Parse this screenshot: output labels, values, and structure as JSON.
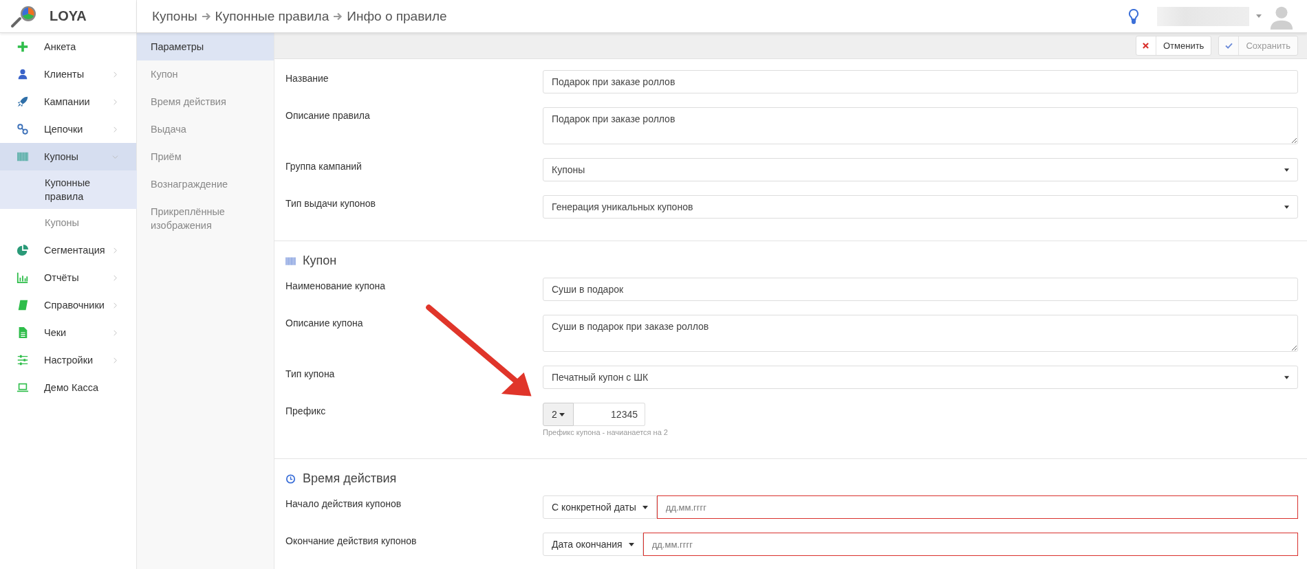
{
  "logo": {
    "name": "LOYA"
  },
  "breadcrumb": [
    "Купоны",
    "Купонные правила",
    "Инфо о правиле"
  ],
  "sidebar": {
    "items": [
      {
        "label": "Анкета",
        "kind": "link",
        "selected": false
      },
      {
        "label": "Клиенты",
        "kind": "group",
        "expanded": false,
        "selected": false
      },
      {
        "label": "Кампании",
        "kind": "group",
        "expanded": false,
        "selected": false
      },
      {
        "label": "Цепочки",
        "kind": "group",
        "expanded": false,
        "selected": false
      },
      {
        "label": "Купоны",
        "kind": "group",
        "expanded": true,
        "selected": true,
        "children": [
          {
            "label": "Купонные правила",
            "selected": true
          },
          {
            "label": "Купоны",
            "selected": false
          }
        ]
      },
      {
        "label": "Сегментация",
        "kind": "group",
        "expanded": false,
        "selected": false
      },
      {
        "label": "Отчёты",
        "kind": "group",
        "expanded": false,
        "selected": false
      },
      {
        "label": "Справочники",
        "kind": "group",
        "expanded": false,
        "selected": false
      },
      {
        "label": "Чеки",
        "kind": "group",
        "expanded": false,
        "selected": false
      },
      {
        "label": "Настройки",
        "kind": "group",
        "expanded": false,
        "selected": false
      },
      {
        "label": "Демо Касса",
        "kind": "link",
        "selected": false
      }
    ]
  },
  "section_nav": [
    {
      "label": "Параметры",
      "selected": true
    },
    {
      "label": "Купон",
      "selected": false
    },
    {
      "label": "Время действия",
      "selected": false
    },
    {
      "label": "Выдача",
      "selected": false
    },
    {
      "label": "Приём",
      "selected": false
    },
    {
      "label": "Вознаграждение",
      "selected": false
    },
    {
      "label": "Прикреплённые изображения",
      "selected": false
    }
  ],
  "toolbar": [
    {
      "label": "Отменить",
      "kind": "cancel",
      "disabled": false
    },
    {
      "label": "Сохранить",
      "kind": "save",
      "disabled": true
    }
  ],
  "sections": [
    {
      "fields": [
        {
          "label": "Название",
          "kind": "text",
          "value": "Подарок при заказе роллов"
        },
        {
          "label": "Описание правила",
          "kind": "textarea",
          "value": "Подарок при заказе роллов"
        },
        {
          "label": "Группа кампаний",
          "kind": "select",
          "value": "Купоны"
        },
        {
          "label": "Тип выдачи купонов",
          "kind": "select",
          "value": "Генерация уникальных купонов"
        }
      ]
    },
    {
      "title": "Купон",
      "fields": [
        {
          "label": "Наименование купона",
          "kind": "text",
          "value": "Суши в подарок"
        },
        {
          "label": "Описание купона",
          "kind": "textarea",
          "value": "Суши в подарок при заказе роллов"
        },
        {
          "label": "Тип купона",
          "kind": "select",
          "value": "Печатный купон с ШК"
        },
        {
          "label": "Префикс",
          "kind": "prefix",
          "prefix": "2",
          "value": "12345",
          "help": "Префикс купона - начианается на 2"
        }
      ]
    },
    {
      "title": "Время действия",
      "fields": [
        {
          "label": "Начало действия купонов",
          "kind": "date",
          "mode": "С конкретной даты",
          "placeholder": "дд.мм.гггг",
          "invalid": true
        },
        {
          "label": "Окончание действия купонов",
          "kind": "date",
          "mode": "Дата окончания",
          "placeholder": "дд.мм.гггг",
          "invalid": true
        }
      ]
    }
  ]
}
